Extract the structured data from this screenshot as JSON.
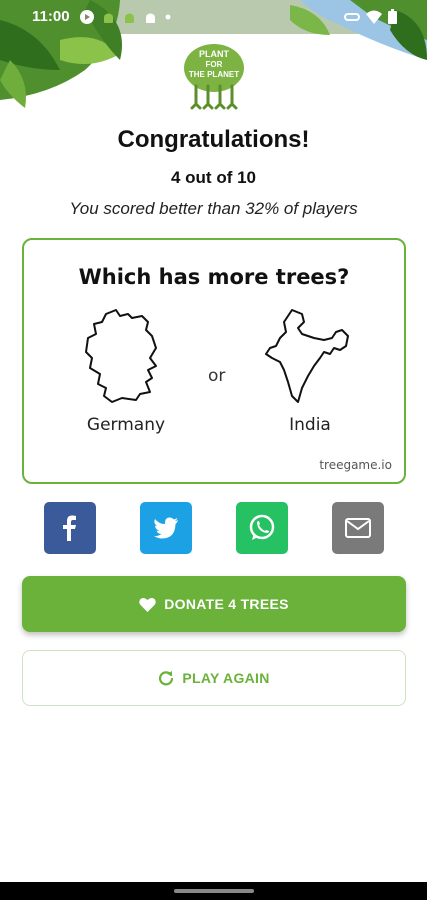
{
  "status_bar": {
    "time": "11:00",
    "left_icons": [
      "play-icon",
      "android-icon",
      "android-icon",
      "android-icon",
      "dot-icon"
    ],
    "right_icons": [
      "vpn-icon",
      "wifi-icon",
      "battery-icon"
    ]
  },
  "header": {
    "logo_text": "PLANT FOR THE PLANET"
  },
  "result": {
    "title": "Congratulations!",
    "score": "4 out of 10",
    "percent_text": "You scored better than 32% of players"
  },
  "card": {
    "question": "Which has more trees?",
    "left_country": "Germany",
    "or_label": "or",
    "right_country": "India",
    "site": "treegame.io"
  },
  "share": {
    "buttons": [
      {
        "icon": "facebook-icon",
        "color": "#3b5a9a"
      },
      {
        "icon": "twitter-icon",
        "color": "#1da1e5"
      },
      {
        "icon": "whatsapp-icon",
        "color": "#25c162"
      },
      {
        "icon": "mail-icon",
        "color": "#7a7a7a"
      }
    ]
  },
  "actions": {
    "donate_label": "DONATE 4 TREES",
    "play_again_label": "PLAY AGAIN"
  },
  "colors": {
    "accent": "#6ab23a"
  }
}
